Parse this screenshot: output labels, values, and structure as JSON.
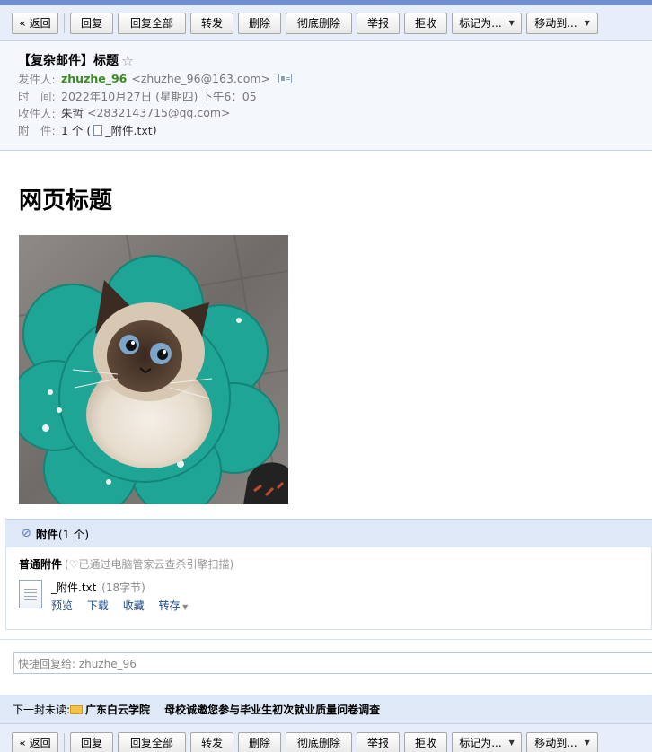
{
  "toolbar": {
    "back": "« 返回",
    "reply": "回复",
    "reply_all": "回复全部",
    "forward": "转发",
    "delete": "删除",
    "delete_forever": "彻底删除",
    "report": "举报",
    "reject": "拒收",
    "mark_as": "标记为...",
    "move_to": "移动到..."
  },
  "email": {
    "subject": "【复杂邮件】标题",
    "sender_label": "发件人:",
    "sender_name": "zhuzhe_96",
    "sender_email": "<zhuzhe_96@163.com>",
    "time_label": "时　间:",
    "time_value": "2022年10月27日 (星期四) 下午6：05",
    "recipient_label": "收件人:",
    "recipient_name": "朱哲",
    "recipient_email": "<2832143715@qq.com>",
    "attachment_label": "附　件:",
    "attachment_count_prefix": "1 个 (",
    "attachment_name": "_附件.txt",
    "attachment_suffix": ")"
  },
  "body": {
    "page_title": "网页标题"
  },
  "attachments": {
    "header_label": "附件",
    "header_count": "(1 个)",
    "type_label": "普通附件",
    "scan_note": "(♡已通过电脑管家云查杀引擎扫描)",
    "file_name": "_附件.txt",
    "file_size": "(18字节)",
    "action_preview": "预览",
    "action_download": "下载",
    "action_collect": "收藏",
    "action_save": "转存"
  },
  "quick_reply": {
    "placeholder": "快捷回复给: zhuzhe_96"
  },
  "next_unread": {
    "label": "下一封未读:",
    "sender": "广东白云学院",
    "subject": "母校诚邀您参与毕业生初次就业质量问卷调查"
  }
}
